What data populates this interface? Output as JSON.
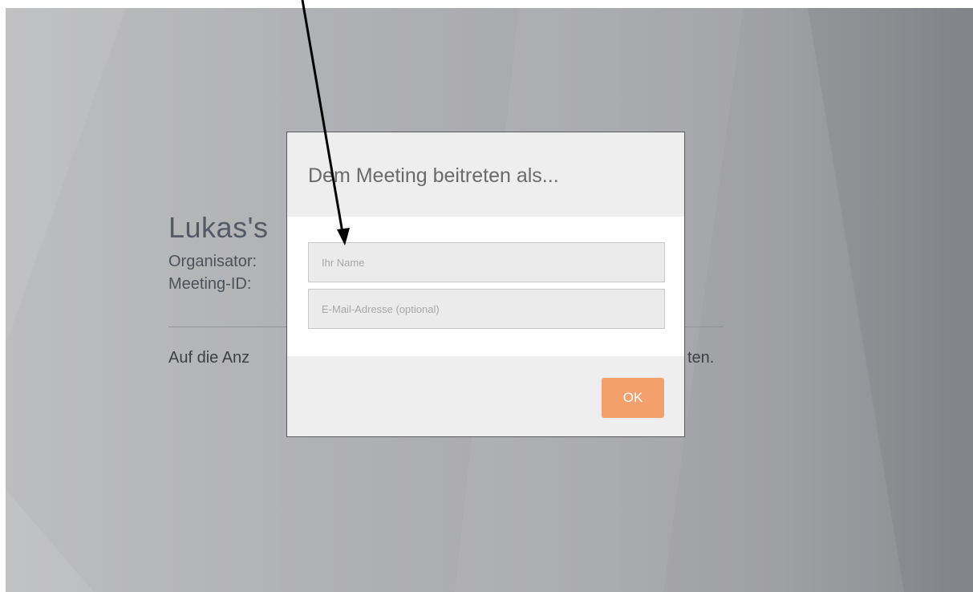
{
  "background_page": {
    "title_visible": "Lukas's",
    "organizer_label": "Organisator:",
    "meeting_id_label": "Meeting-ID:",
    "instruction_start": "Auf die Anz",
    "instruction_end": "ten."
  },
  "dialog": {
    "title": "Dem Meeting beitreten als...",
    "name_placeholder": "Ihr Name",
    "email_placeholder": "E-Mail-Adresse (optional)",
    "ok_label": "OK"
  },
  "colors": {
    "ok_button": "#f4a06d",
    "dialog_panel": "#eeeeee",
    "annotation_arrow": "#000000"
  }
}
